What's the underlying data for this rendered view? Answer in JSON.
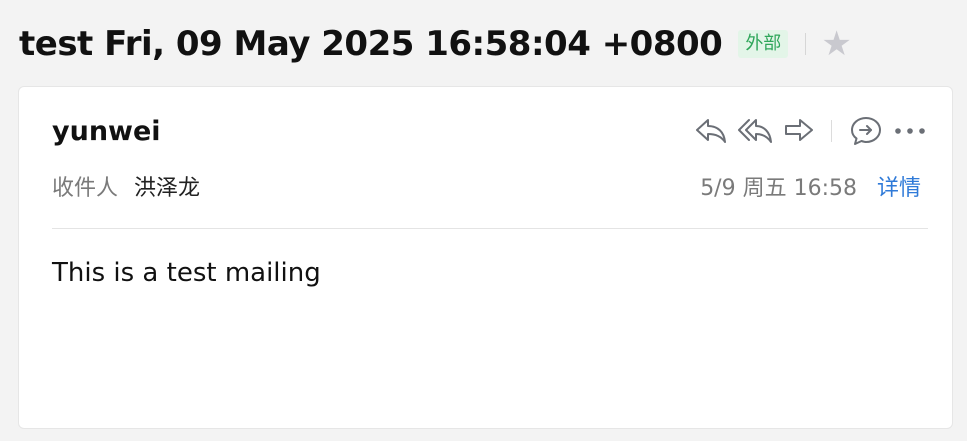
{
  "header": {
    "subject": "test Fri, 09 May 2025 16:58:04 +0800",
    "external_badge": "外部",
    "star_icon": "star-icon"
  },
  "message": {
    "sender": "yunwei",
    "recipient_label": "收件人",
    "recipient": "洪泽龙",
    "date": "5/9 周五 16:58",
    "details_link": "详情",
    "body": "This is a test mailing"
  },
  "actions": [
    {
      "name": "reply",
      "icon": "reply-icon"
    },
    {
      "name": "reply-all",
      "icon": "reply-all-icon"
    },
    {
      "name": "forward",
      "icon": "forward-icon"
    },
    {
      "name": "chat",
      "icon": "chat-icon"
    },
    {
      "name": "more",
      "icon": "more-icon"
    }
  ],
  "colors": {
    "badge_bg": "#e3f5e8",
    "badge_text": "#2fa65a",
    "link": "#2f7ad8",
    "icon": "#6b6f76",
    "star": "#c9c9cf"
  }
}
